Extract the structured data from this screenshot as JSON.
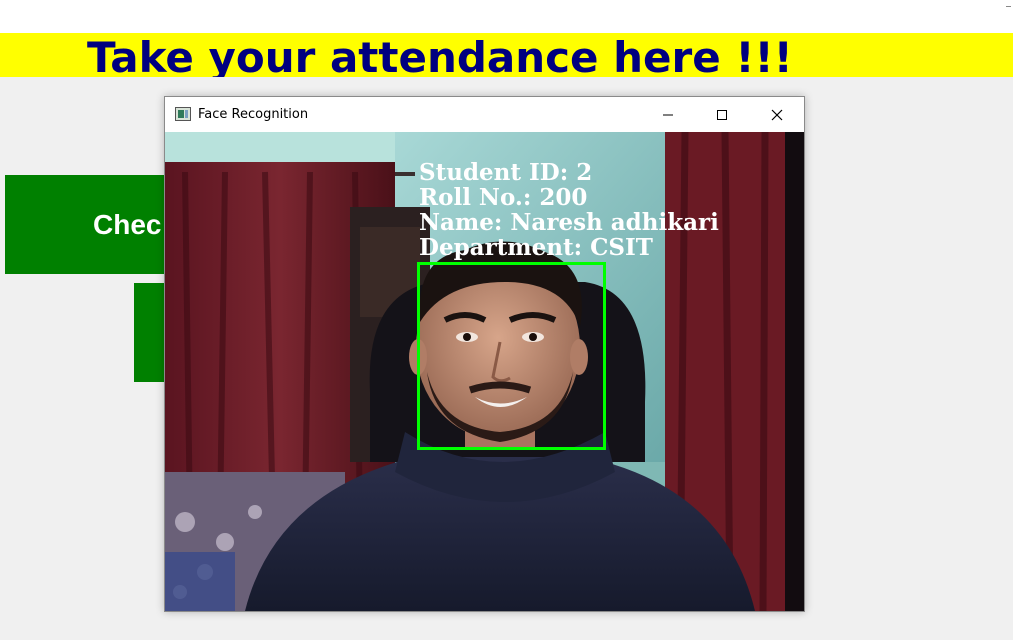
{
  "banner": {
    "title": "Take your attendance here !!!"
  },
  "buttons": {
    "check_label": "Chec",
    "second_label": ""
  },
  "window": {
    "title": "Face Recognition",
    "controls": {
      "minimize": "minimize",
      "maximize": "maximize",
      "close": "close"
    }
  },
  "overlay": {
    "student_id": "Student ID: 2",
    "roll_no": "Roll No.: 200",
    "name": "Name: Naresh adhikari",
    "department": "Department: CSIT"
  },
  "colors": {
    "banner_bg": "#ffff00",
    "banner_text": "#000080",
    "button_bg": "#008000",
    "face_box": "#00ff00"
  },
  "icons": [
    "app-icon",
    "minimize-icon",
    "maximize-icon",
    "close-icon"
  ]
}
